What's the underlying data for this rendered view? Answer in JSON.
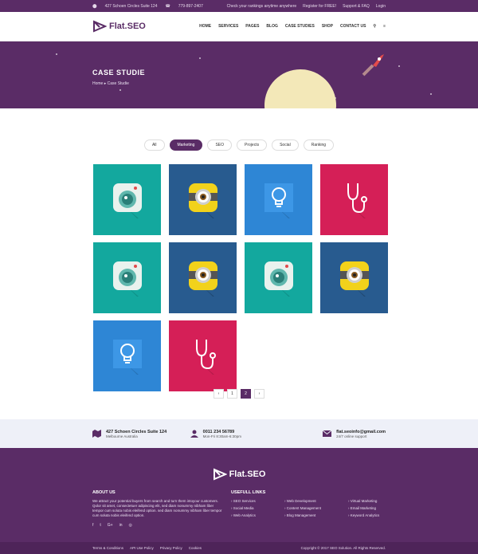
{
  "topbar": {
    "address": "427 Schoen Circles Suite 124",
    "phone": "779-897-2407",
    "links": [
      "Check your rankings anytime anywhere",
      "Register for FREE!",
      "Support & FAQ",
      "Login"
    ]
  },
  "brand": {
    "name": "Flat.SEO"
  },
  "nav": {
    "items": [
      "HOME",
      "SERVICES",
      "PAGES",
      "BLOG",
      "CASE STUDIES",
      "SHOP",
      "CONTACT US"
    ]
  },
  "hero": {
    "title": "CASE STUDIE",
    "breadcrumb_home": "Home",
    "breadcrumb_current": "Case Studie"
  },
  "filters": [
    "All",
    "Marketing",
    "SEO",
    "Projects",
    "Social",
    "Ranking"
  ],
  "filters_active": "Marketing",
  "tiles": [
    {
      "icon": "camera-icon",
      "color": "#13a89e"
    },
    {
      "icon": "minion-eye-icon",
      "color": "#285b8f"
    },
    {
      "icon": "lightbulb-icon",
      "color": "#2e86d5"
    },
    {
      "icon": "stethoscope-icon",
      "color": "#d51f57"
    },
    {
      "icon": "camera-icon",
      "color": "#13a89e"
    },
    {
      "icon": "minion-eye-icon",
      "color": "#285b8f"
    },
    {
      "icon": "camera-icon",
      "color": "#13a89e"
    },
    {
      "icon": "minion-eye-icon",
      "color": "#285b8f"
    },
    {
      "icon": "lightbulb-icon",
      "color": "#2e86d5"
    },
    {
      "icon": "stethoscope-icon",
      "color": "#d51f57"
    }
  ],
  "pager": {
    "prev": "‹",
    "pages": [
      "1",
      "2"
    ],
    "active": "2",
    "next": "›"
  },
  "contact": {
    "address_title": "427 Schoen Circles Suite 124",
    "address_sub": "Melbourne Australia",
    "phone_title": "0011 234 56789",
    "phone_sub": "Mon-Fri 8:30am-6:30pm",
    "email_title": "flat.seoinfo@gmail.com",
    "email_sub": "24/7 online support"
  },
  "footer": {
    "about_title": "ABOUT US",
    "about_text": "We attract your potential buyers from search and turn them intoyour customers. Qolor sit amet, consectetuer adipiscing elit, sed diam nonummy nibham liber tempor cum soluta nobis eleifend option. sed diam nonummy nibham liber tempor cum soluta nobis eleifend option.",
    "links_title": "USEFULL LINKS",
    "links": [
      "SEO Services",
      "Web Development",
      "Virtual Marketing",
      "Social Media",
      "Content Management",
      "Email Marketing",
      "Web Analytics",
      "Blog Management",
      "Keyword Analytics"
    ],
    "social": [
      "f",
      "t",
      "G+",
      "in",
      "◎"
    ]
  },
  "bottom": {
    "links": [
      "Terms & Conditions",
      "API Use Policy",
      "Privacy Policy",
      "Cookies"
    ],
    "copyright": "Copyright © 2017 SEO Solution. All Rights Reserved."
  },
  "colors": {
    "brand": "#5a2c66",
    "teal": "#13a89e",
    "navy": "#285b8f",
    "blue": "#2e86d5",
    "crimson": "#d51f57"
  }
}
